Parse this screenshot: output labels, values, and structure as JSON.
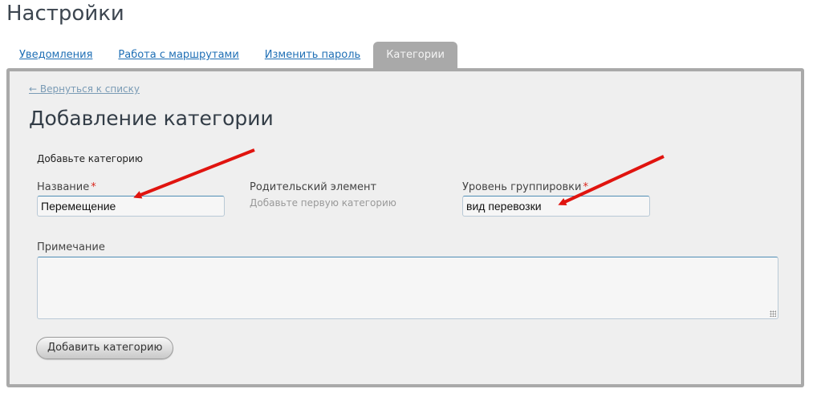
{
  "page": {
    "title": "Настройки"
  },
  "tabs": [
    {
      "label": "Уведомления",
      "active": false
    },
    {
      "label": "Работа с маршрутами",
      "active": false
    },
    {
      "label": "Изменить пароль",
      "active": false
    },
    {
      "label": "Категории",
      "active": true
    }
  ],
  "form": {
    "back_link": "← Вернуться к списку",
    "title": "Добавление категории",
    "hint": "Добавьте категорию",
    "name_label": "Название",
    "name_value": "Перемещение",
    "required_mark": "*",
    "parent_label": "Родительский элемент",
    "parent_hint": "Добавьте первую категорию",
    "group_label": "Уровень группировки",
    "group_value": "вид перевозки",
    "note_label": "Примечание",
    "note_value": "",
    "submit_label": "Добавить категорию"
  },
  "colors": {
    "accent_link": "#1f6fb5",
    "active_tab": "#a9a9a9",
    "required": "#d9261c",
    "annotation_arrow": "#e0140f"
  }
}
